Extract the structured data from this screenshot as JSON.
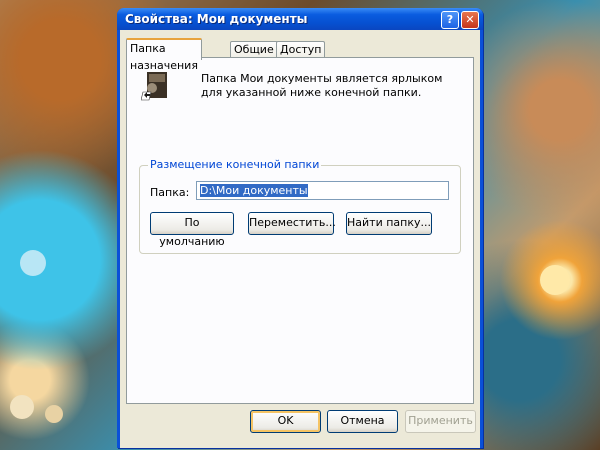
{
  "window": {
    "title": "Свойства: Мои документы",
    "help_label": "?",
    "close_label": "✕"
  },
  "tabs": [
    {
      "label": "Папка назначения",
      "active": true
    },
    {
      "label": "Общие",
      "active": false
    },
    {
      "label": "Доступ",
      "active": false
    }
  ],
  "panel": {
    "description": "Папка Мои документы является ярлыком для указанной ниже конечной папки.",
    "group_title": "Размещение конечной папки",
    "folder_label": "Папка:",
    "folder_path": "D:\\Мои документы",
    "default_button": "По умолчанию",
    "move_button": "Переместить...",
    "find_button": "Найти папку..."
  },
  "footer": {
    "ok_label": "OK",
    "cancel_label": "Отмена",
    "apply_label": "Применить"
  },
  "colors": {
    "titlebar": "#0a5ce0",
    "group_title": "#0046d5",
    "tab_accent": "#e8a33c"
  }
}
